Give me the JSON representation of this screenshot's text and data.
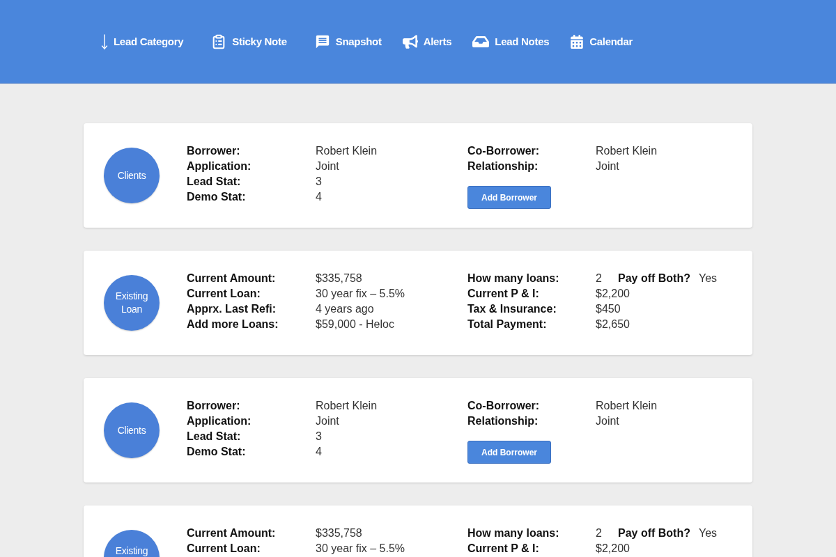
{
  "nav": [
    {
      "label": "Lead Category"
    },
    {
      "label": "Sticky Note"
    },
    {
      "label": "Snapshot"
    },
    {
      "label": "Alerts"
    },
    {
      "label": "Lead Notes"
    },
    {
      "label": "Calendar"
    }
  ],
  "cards": [
    {
      "kind": "clients",
      "badge": "Clients",
      "left_rows": [
        {
          "label": "Borrower:",
          "value": "Robert Klein"
        },
        {
          "label": "Application:",
          "value": "Joint"
        },
        {
          "label": "Lead Stat:",
          "value": "3"
        },
        {
          "label": "Demo Stat:",
          "value": "4"
        }
      ],
      "right_rows": [
        {
          "label": "Co-Borrower:",
          "value": "Robert Klein"
        },
        {
          "label": "Relationship:",
          "value": "Joint"
        }
      ],
      "button": "Add Borrower"
    },
    {
      "kind": "existing_loan",
      "badge": "Existing Loan",
      "left_rows": [
        {
          "label": "Current Amount:",
          "value": "$335,758"
        },
        {
          "label": "Current Loan:",
          "value": "30 year fix – 5.5%"
        },
        {
          "label": "Apprx. Last Refi:",
          "value": "4 years ago"
        },
        {
          "label": "Add more Loans:",
          "value": "$59,000 - Heloc"
        }
      ],
      "right_rows": [
        {
          "label": "How many loans:",
          "value": "2",
          "extra_label": "Pay off Both?",
          "extra_value": "Yes"
        },
        {
          "label": "Current P & I:",
          "value": "$2,200"
        },
        {
          "label": "Tax & Insurance:",
          "value": "$450"
        },
        {
          "label": "Total Payment:",
          "value": "$2,650"
        }
      ]
    },
    {
      "kind": "clients",
      "badge": "Clients",
      "left_rows": [
        {
          "label": "Borrower:",
          "value": "Robert Klein"
        },
        {
          "label": "Application:",
          "value": "Joint"
        },
        {
          "label": "Lead Stat:",
          "value": "3"
        },
        {
          "label": "Demo Stat:",
          "value": "4"
        }
      ],
      "right_rows": [
        {
          "label": "Co-Borrower:",
          "value": "Robert Klein"
        },
        {
          "label": "Relationship:",
          "value": "Joint"
        }
      ],
      "button": "Add Borrower"
    },
    {
      "kind": "existing_loan",
      "badge": "Existing",
      "left_rows": [
        {
          "label": "Current Amount:",
          "value": "$335,758"
        },
        {
          "label": "Current Loan:",
          "value": "30 year fix – 5.5%"
        }
      ],
      "right_rows": [
        {
          "label": "How many loans:",
          "value": "2",
          "extra_label": "Pay off Both?",
          "extra_value": "Yes"
        },
        {
          "label": "Current P & I:",
          "value": "$2,200"
        }
      ]
    }
  ]
}
